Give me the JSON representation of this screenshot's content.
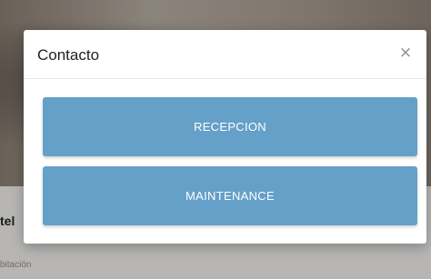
{
  "background": {
    "card_title": "tel",
    "card_subtitle": "bitación"
  },
  "modal": {
    "title": "Contacto",
    "close_label": "×",
    "buttons": [
      {
        "label": "RECEPCION"
      },
      {
        "label": "MAINTENANCE"
      }
    ]
  },
  "colors": {
    "button": "#64a0c8",
    "button_text": "#ffffff",
    "overlay": "rgba(20,20,20,0.28)"
  }
}
